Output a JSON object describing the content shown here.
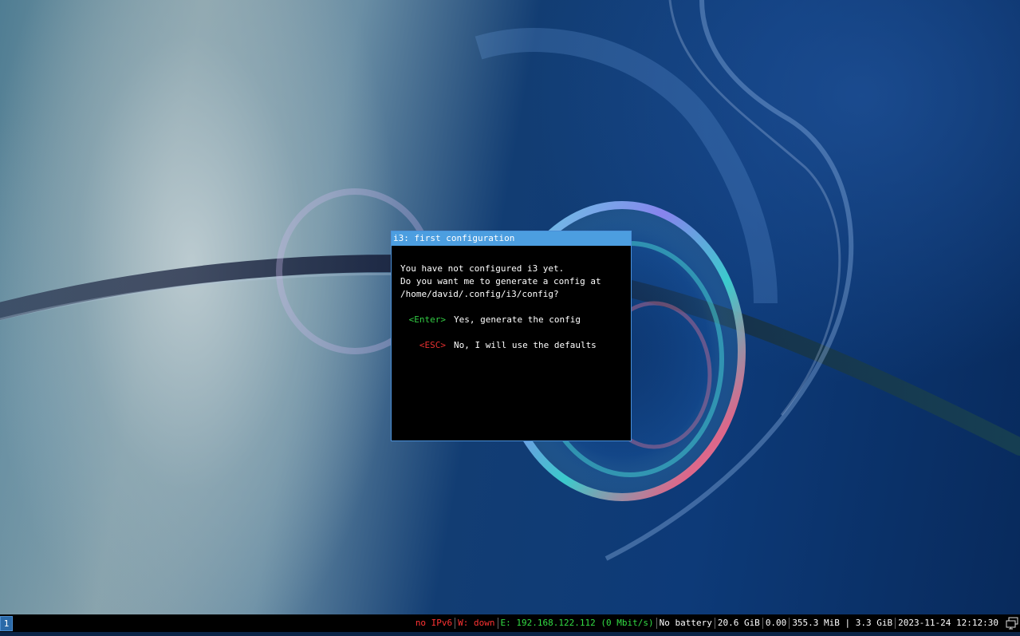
{
  "dialog": {
    "title": "i3: first configuration",
    "message_lines": [
      "You have not configured i3 yet.",
      "Do you want me to generate a config at",
      "/home/david/.config/i3/config?"
    ],
    "options": [
      {
        "key": "<Enter>",
        "label": "Yes, generate the config",
        "key_color": "#33cc44"
      },
      {
        "key": "<ESC>",
        "label": "No, I will use the defaults",
        "key_color": "#e83030"
      }
    ]
  },
  "bar": {
    "workspace": "1",
    "status": {
      "ipv6": "no IPv6",
      "wireless": "W: down",
      "ethernet": "E: 192.168.122.112 (0 Mbit/s)",
      "battery": "No battery",
      "disk": "20.6 GiB",
      "load": "0.00",
      "memory": "355.3 MiB | 3.3 GiB",
      "datetime": "2023-11-24 12:12:30"
    },
    "tray_icon": "network-tray-icon"
  },
  "colors": {
    "accent": "#4c9ee0",
    "status_bad": "#ff3333",
    "status_good": "#33dd44"
  }
}
